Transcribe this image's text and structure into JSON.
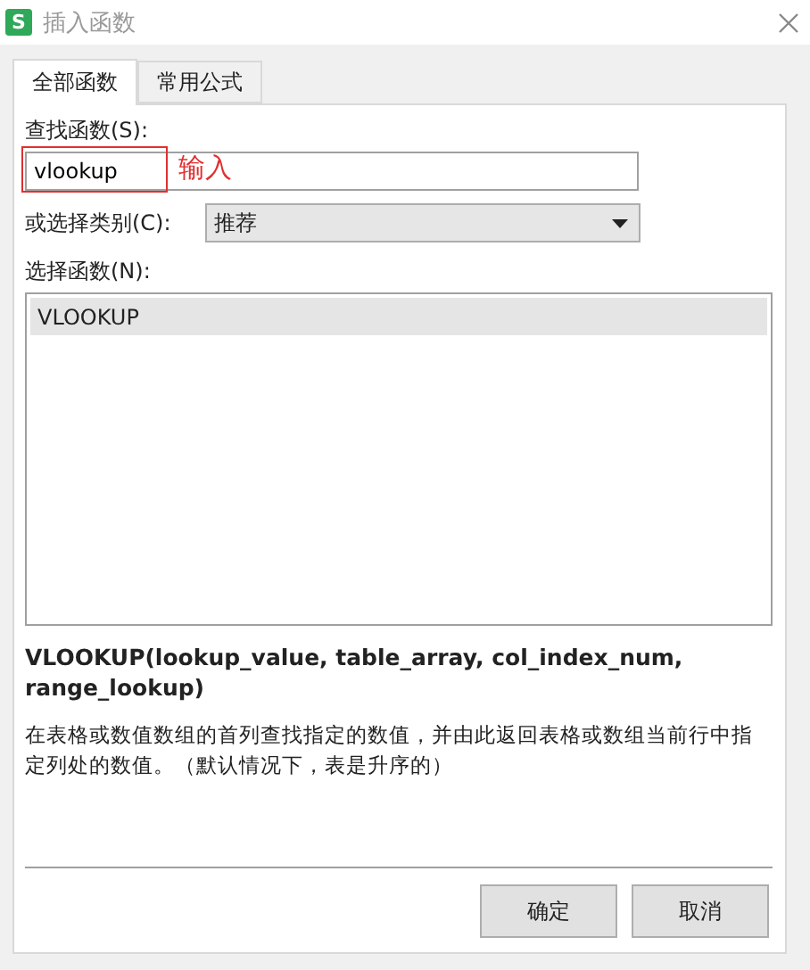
{
  "window": {
    "title": "插入函数",
    "app_icon": "S"
  },
  "tabs": [
    {
      "label": "全部函数",
      "selected": true
    },
    {
      "label": "常用公式",
      "selected": false
    }
  ],
  "search": {
    "label": "查找函数(S):",
    "value": "vlookup",
    "annotation": "输入"
  },
  "category": {
    "label": "或选择类别(C):",
    "value": "推荐"
  },
  "functions": {
    "label": "选择函数(N):",
    "items": [
      {
        "name": "VLOOKUP",
        "selected": true
      }
    ]
  },
  "signature": "VLOOKUP(lookup_value, table_array, col_index_num, range_lookup)",
  "description": "在表格或数值数组的首列查找指定的数值，并由此返回表格或数组当前行中指定列处的数值。（默认情况下，表是升序的）",
  "buttons": [
    "确定",
    "取消"
  ]
}
